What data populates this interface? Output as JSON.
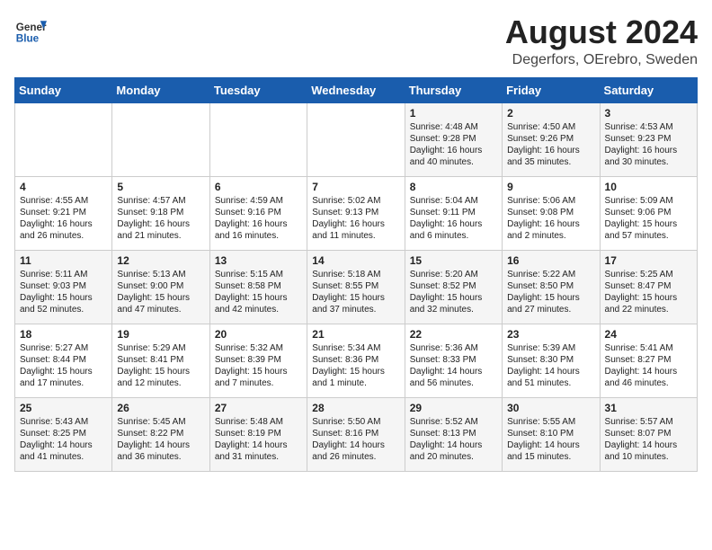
{
  "header": {
    "logo_general": "General",
    "logo_blue": "Blue",
    "month_year": "August 2024",
    "location": "Degerfors, OErebro, Sweden"
  },
  "days_of_week": [
    "Sunday",
    "Monday",
    "Tuesday",
    "Wednesday",
    "Thursday",
    "Friday",
    "Saturday"
  ],
  "weeks": [
    [
      {
        "day": "",
        "info": ""
      },
      {
        "day": "",
        "info": ""
      },
      {
        "day": "",
        "info": ""
      },
      {
        "day": "",
        "info": ""
      },
      {
        "day": "1",
        "info": "Sunrise: 4:48 AM\nSunset: 9:28 PM\nDaylight: 16 hours\nand 40 minutes."
      },
      {
        "day": "2",
        "info": "Sunrise: 4:50 AM\nSunset: 9:26 PM\nDaylight: 16 hours\nand 35 minutes."
      },
      {
        "day": "3",
        "info": "Sunrise: 4:53 AM\nSunset: 9:23 PM\nDaylight: 16 hours\nand 30 minutes."
      }
    ],
    [
      {
        "day": "4",
        "info": "Sunrise: 4:55 AM\nSunset: 9:21 PM\nDaylight: 16 hours\nand 26 minutes."
      },
      {
        "day": "5",
        "info": "Sunrise: 4:57 AM\nSunset: 9:18 PM\nDaylight: 16 hours\nand 21 minutes."
      },
      {
        "day": "6",
        "info": "Sunrise: 4:59 AM\nSunset: 9:16 PM\nDaylight: 16 hours\nand 16 minutes."
      },
      {
        "day": "7",
        "info": "Sunrise: 5:02 AM\nSunset: 9:13 PM\nDaylight: 16 hours\nand 11 minutes."
      },
      {
        "day": "8",
        "info": "Sunrise: 5:04 AM\nSunset: 9:11 PM\nDaylight: 16 hours\nand 6 minutes."
      },
      {
        "day": "9",
        "info": "Sunrise: 5:06 AM\nSunset: 9:08 PM\nDaylight: 16 hours\nand 2 minutes."
      },
      {
        "day": "10",
        "info": "Sunrise: 5:09 AM\nSunset: 9:06 PM\nDaylight: 15 hours\nand 57 minutes."
      }
    ],
    [
      {
        "day": "11",
        "info": "Sunrise: 5:11 AM\nSunset: 9:03 PM\nDaylight: 15 hours\nand 52 minutes."
      },
      {
        "day": "12",
        "info": "Sunrise: 5:13 AM\nSunset: 9:00 PM\nDaylight: 15 hours\nand 47 minutes."
      },
      {
        "day": "13",
        "info": "Sunrise: 5:15 AM\nSunset: 8:58 PM\nDaylight: 15 hours\nand 42 minutes."
      },
      {
        "day": "14",
        "info": "Sunrise: 5:18 AM\nSunset: 8:55 PM\nDaylight: 15 hours\nand 37 minutes."
      },
      {
        "day": "15",
        "info": "Sunrise: 5:20 AM\nSunset: 8:52 PM\nDaylight: 15 hours\nand 32 minutes."
      },
      {
        "day": "16",
        "info": "Sunrise: 5:22 AM\nSunset: 8:50 PM\nDaylight: 15 hours\nand 27 minutes."
      },
      {
        "day": "17",
        "info": "Sunrise: 5:25 AM\nSunset: 8:47 PM\nDaylight: 15 hours\nand 22 minutes."
      }
    ],
    [
      {
        "day": "18",
        "info": "Sunrise: 5:27 AM\nSunset: 8:44 PM\nDaylight: 15 hours\nand 17 minutes."
      },
      {
        "day": "19",
        "info": "Sunrise: 5:29 AM\nSunset: 8:41 PM\nDaylight: 15 hours\nand 12 minutes."
      },
      {
        "day": "20",
        "info": "Sunrise: 5:32 AM\nSunset: 8:39 PM\nDaylight: 15 hours\nand 7 minutes."
      },
      {
        "day": "21",
        "info": "Sunrise: 5:34 AM\nSunset: 8:36 PM\nDaylight: 15 hours\nand 1 minute."
      },
      {
        "day": "22",
        "info": "Sunrise: 5:36 AM\nSunset: 8:33 PM\nDaylight: 14 hours\nand 56 minutes."
      },
      {
        "day": "23",
        "info": "Sunrise: 5:39 AM\nSunset: 8:30 PM\nDaylight: 14 hours\nand 51 minutes."
      },
      {
        "day": "24",
        "info": "Sunrise: 5:41 AM\nSunset: 8:27 PM\nDaylight: 14 hours\nand 46 minutes."
      }
    ],
    [
      {
        "day": "25",
        "info": "Sunrise: 5:43 AM\nSunset: 8:25 PM\nDaylight: 14 hours\nand 41 minutes."
      },
      {
        "day": "26",
        "info": "Sunrise: 5:45 AM\nSunset: 8:22 PM\nDaylight: 14 hours\nand 36 minutes."
      },
      {
        "day": "27",
        "info": "Sunrise: 5:48 AM\nSunset: 8:19 PM\nDaylight: 14 hours\nand 31 minutes."
      },
      {
        "day": "28",
        "info": "Sunrise: 5:50 AM\nSunset: 8:16 PM\nDaylight: 14 hours\nand 26 minutes."
      },
      {
        "day": "29",
        "info": "Sunrise: 5:52 AM\nSunset: 8:13 PM\nDaylight: 14 hours\nand 20 minutes."
      },
      {
        "day": "30",
        "info": "Sunrise: 5:55 AM\nSunset: 8:10 PM\nDaylight: 14 hours\nand 15 minutes."
      },
      {
        "day": "31",
        "info": "Sunrise: 5:57 AM\nSunset: 8:07 PM\nDaylight: 14 hours\nand 10 minutes."
      }
    ]
  ]
}
